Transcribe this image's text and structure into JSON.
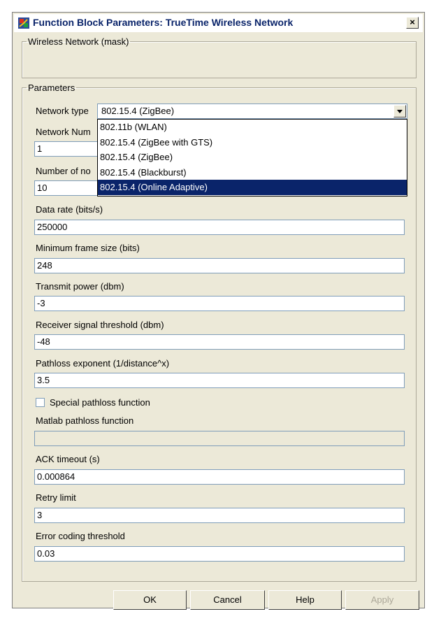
{
  "window": {
    "title": "Function Block Parameters: TrueTime Wireless  Network",
    "close_label": "×"
  },
  "mask_group": {
    "legend": "Wireless Network (mask)"
  },
  "params_group": {
    "legend": "Parameters"
  },
  "network_type": {
    "label": "Network type",
    "selected": "802.15.4 (ZigBee)",
    "options": [
      "802.11b (WLAN)",
      "802.15.4 (ZigBee with GTS)",
      "802.15.4 (ZigBee)",
      "802.15.4 (Blackburst)",
      "802.15.4 (Online Adaptive)"
    ],
    "highlighted_option": "802.15.4 (Online Adaptive)"
  },
  "network_number": {
    "label": "Network Num",
    "value": "1"
  },
  "number_of_nodes": {
    "label": "Number of no",
    "value": "10"
  },
  "data_rate": {
    "label": "Data rate (bits/s)",
    "value": "250000"
  },
  "min_frame_size": {
    "label": "Minimum frame size (bits)",
    "value": "248"
  },
  "transmit_power": {
    "label": "Transmit power (dbm)",
    "value": "-3"
  },
  "receiver_threshold": {
    "label": "Receiver signal threshold (dbm)",
    "value": "-48"
  },
  "pathloss_exponent": {
    "label": "Pathloss exponent (1/distance^x)",
    "value": "3.5"
  },
  "special_pathloss": {
    "label": "Special pathloss function",
    "checked": false
  },
  "matlab_pathloss": {
    "label": "Matlab pathloss function",
    "value": ""
  },
  "ack_timeout": {
    "label": "ACK timeout (s)",
    "value": "0.000864"
  },
  "retry_limit": {
    "label": "Retry limit",
    "value": "3"
  },
  "error_coding": {
    "label": "Error coding threshold",
    "value": "0.03"
  },
  "buttons": {
    "ok": "OK",
    "cancel": "Cancel",
    "help": "Help",
    "apply": "Apply"
  },
  "colors": {
    "selection": "#0a246a",
    "dialog_bg": "#ece9d8",
    "title_text": "#0a246a"
  }
}
